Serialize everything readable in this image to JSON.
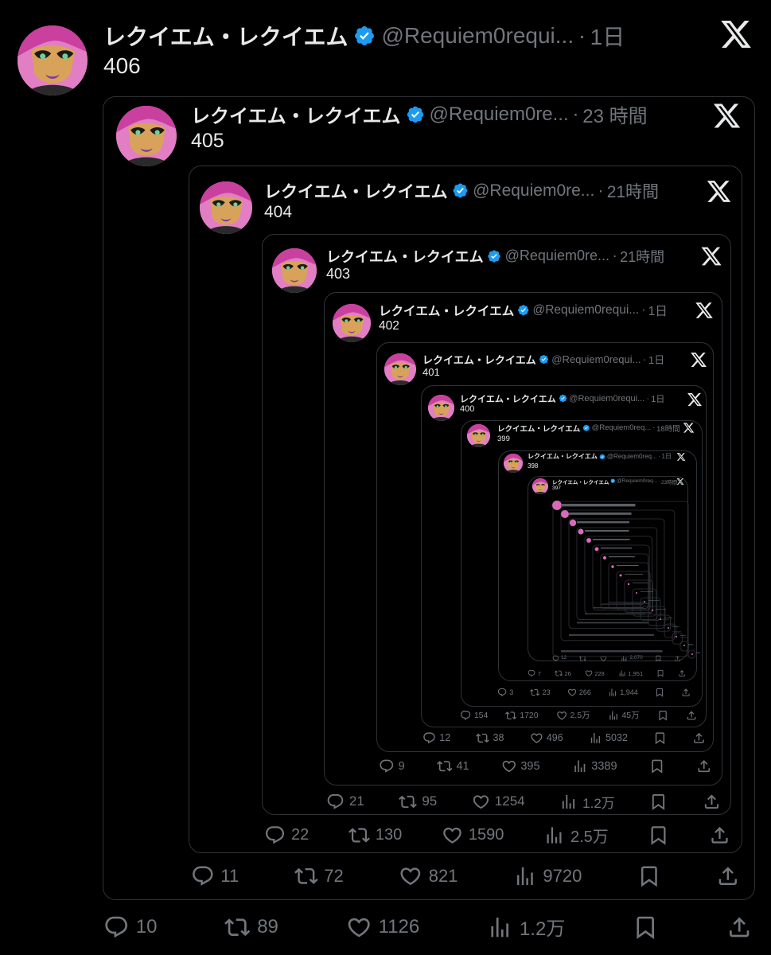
{
  "tweets": [
    {
      "name": "レクイエム・レクイエム",
      "handle": "@Requiem0requi...",
      "time": "1日",
      "text": "406",
      "replies": "10",
      "retweets": "89",
      "likes": "1126",
      "views": "1.2万"
    },
    {
      "name": "レクイエム・レクイエム",
      "handle": "@Requiem0re...",
      "time": "23 時間",
      "text": "405",
      "replies": "11",
      "retweets": "72",
      "likes": "821",
      "views": "9720"
    },
    {
      "name": "レクイエム・レクイエム",
      "handle": "@Requiem0re...",
      "time": "21時間",
      "text": "404",
      "replies": "22",
      "retweets": "130",
      "likes": "1590",
      "views": "2.5万"
    },
    {
      "name": "レクイエム・レクイエム",
      "handle": "@Requiem0re...",
      "time": "21時間",
      "text": "403",
      "replies": "21",
      "retweets": "95",
      "likes": "1254",
      "views": "1.2万"
    },
    {
      "name": "レクイエム・レクイエム",
      "handle": "@Requiem0requi...",
      "time": "1日",
      "text": "402",
      "replies": "9",
      "retweets": "41",
      "likes": "395",
      "views": "3389"
    },
    {
      "name": "レクイエム・レクイエム",
      "handle": "@Requiem0requi...",
      "time": "1日",
      "text": "401",
      "replies": "12",
      "retweets": "38",
      "likes": "496",
      "views": "5032"
    },
    {
      "name": "レクイエム・レクイエム",
      "handle": "@Requiem0requi...",
      "time": "1日",
      "text": "400",
      "replies": "154",
      "retweets": "1720",
      "likes": "2.5万",
      "views": "45万"
    },
    {
      "name": "レクイエム・レクイエム",
      "handle": "@Requiem0req...",
      "time": "18時間",
      "text": "399",
      "replies": "3",
      "retweets": "23",
      "likes": "266",
      "views": "1,944"
    },
    {
      "name": "レクイエム・レクイエム",
      "handle": "@Requiem0req...",
      "time": "1日",
      "text": "398",
      "replies": "7",
      "retweets": "26",
      "likes": "228",
      "views": "1,951"
    },
    {
      "name": "レクイエム・レクイエム",
      "handle": "@Requiem0req...",
      "time": "23時間",
      "text": "397",
      "replies": "12",
      "retweets": "",
      "likes": "",
      "views": "2,070"
    }
  ],
  "icons": {
    "verified": "verified-badge-icon",
    "platform": "x-logo-icon",
    "reply": "reply-icon",
    "retweet": "retweet-icon",
    "like": "heart-icon",
    "views": "views-icon",
    "bookmark": "bookmark-icon",
    "share": "share-icon"
  },
  "colors": {
    "background": "#000000",
    "text": "#e7e9ea",
    "muted": "#71767b",
    "border": "#2f3336",
    "verified": "#1d9bf0"
  }
}
